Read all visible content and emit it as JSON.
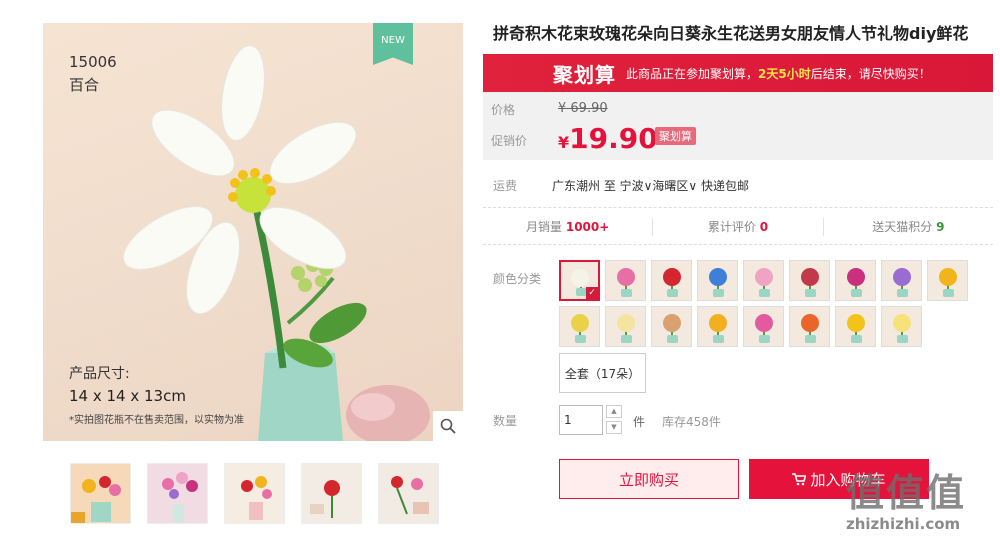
{
  "product": {
    "title": "拼奇积木花束玫瑰花朵向日葵永生花送男女朋友情人节礼物diy鲜花"
  },
  "main_image": {
    "badge": "NEW",
    "code": "15006",
    "name": "百合",
    "size_label": "产品尺寸:",
    "size_value": "14 x 14 x 13cm",
    "note": "*实拍图花瓶不在售卖范围，以实物为准"
  },
  "thumbnails": [
    {
      "id": "t1"
    },
    {
      "id": "t2"
    },
    {
      "id": "t3"
    },
    {
      "id": "t4"
    },
    {
      "id": "t5"
    }
  ],
  "promo_banner": {
    "logo": "聚划算",
    "text_prefix": "此商品正在参加聚划算，",
    "countdown": "2天5小时",
    "text_suffix": "后结束，请尽快购买！"
  },
  "price": {
    "price_label": "价格",
    "original_price": "¥ 69.90",
    "promo_label": "促销价",
    "currency": "¥",
    "promo_price": "19.90",
    "promo_tag": "聚划算"
  },
  "shipping": {
    "label": "运费",
    "value": "广东潮州 至 宁波∨海曙区∨ 快递包邮"
  },
  "stats": {
    "monthly_sales_label": "月销量",
    "monthly_sales": "1000+",
    "reviews_label": "累计评价",
    "reviews": "0",
    "points_label": "送天猫积分",
    "points": "9"
  },
  "color_selector": {
    "label": "颜色分类",
    "swatches": [
      {
        "color": "#f5f2e8",
        "selected": true
      },
      {
        "color": "#e86fa5"
      },
      {
        "color": "#d3262e"
      },
      {
        "color": "#3f7fd8"
      },
      {
        "color": "#f0a3c4"
      },
      {
        "color": "#c23a4a"
      },
      {
        "color": "#c9307e"
      },
      {
        "color": "#9a6bd0"
      },
      {
        "color": "#f2b41c"
      },
      {
        "color": "#e9d24a"
      },
      {
        "color": "#f5e3a0"
      },
      {
        "color": "#d9a070"
      },
      {
        "color": "#f0b020"
      },
      {
        "color": "#e45aa0"
      },
      {
        "color": "#e9652a"
      },
      {
        "color": "#f3c31a"
      },
      {
        "color": "#f7e27a"
      }
    ],
    "full_set_label": "全套（17朵）"
  },
  "quantity": {
    "label": "数量",
    "value": "1",
    "unit": "件",
    "stock": "库存458件"
  },
  "actions": {
    "buy_now": "立即购买",
    "add_to_cart": "加入购物车"
  },
  "watermark": {
    "big": "值值值",
    "small": "zhizhizhi.com"
  }
}
